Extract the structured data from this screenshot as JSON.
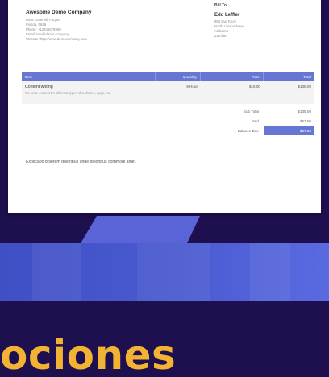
{
  "company": {
    "name": "Awesome Demo Company",
    "lines": [
      "8605 Greenhill Forges",
      "Florida, 5626",
      "Phone: +12345678900",
      "Email: info@demo.company",
      "Website: http://www.democompany.com"
    ]
  },
  "bill_to": {
    "label": "Bill To",
    "name": "Edd Leffler",
    "lines": [
      "984 Eva Knoll",
      "North Linwoodview",
      "Alabama",
      "Zambia"
    ]
  },
  "table": {
    "headers": {
      "item": "Item",
      "quantity": "Quantity",
      "rate": "Rate",
      "total": "Total"
    },
    "rows": [
      {
        "title": "Content writing",
        "description": "We write content for different types of websites, apps, etc.",
        "quantity": "9 Hour",
        "rate": "$15.00",
        "total": "$135.00"
      }
    ]
  },
  "summary": {
    "sub_total_label": "Sub Total",
    "sub_total": "$135.00",
    "paid_label": "Paid",
    "paid": "$67.50",
    "balance_label": "Balance Due",
    "balance": "$67.50"
  },
  "note": "Explicabo dolorem doloribus unde doloribus commodi amet.",
  "headline": "ociones",
  "colors": {
    "background": "#1e0f4e",
    "accent_blue": "#6876d3",
    "headline": "#f2b233"
  }
}
